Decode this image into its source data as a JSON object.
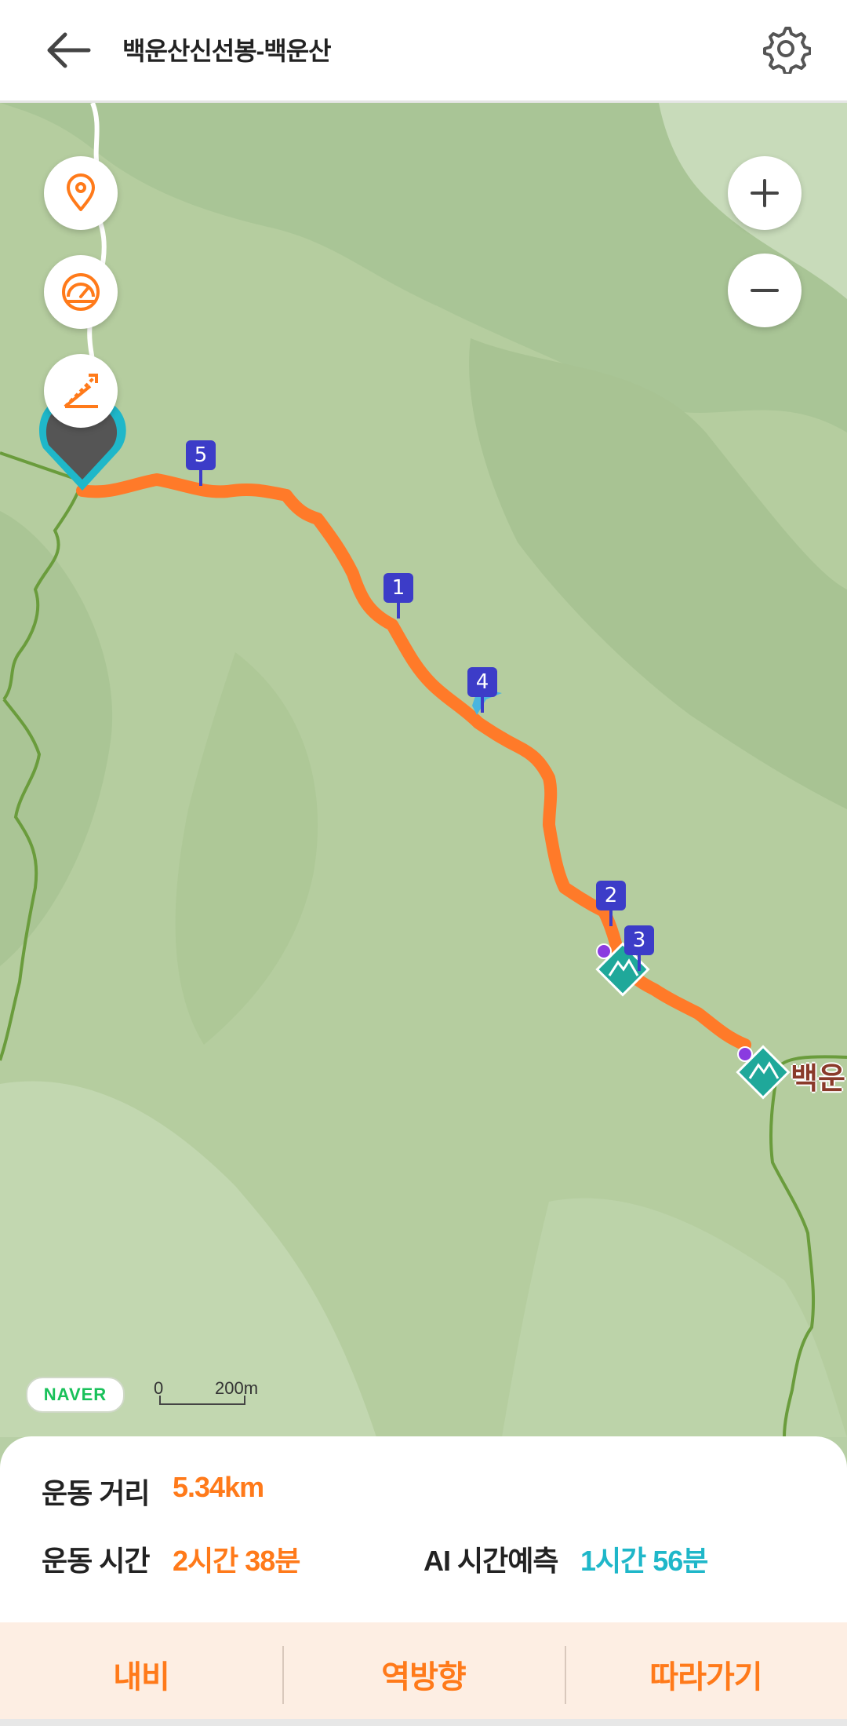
{
  "header": {
    "title": "백운산신선봉-백운산",
    "back_icon": "arrow-left-icon",
    "settings_icon": "gear-icon"
  },
  "map": {
    "controls": {
      "left": [
        "location-pin-icon",
        "speedometer-icon",
        "elevation-slope-icon"
      ],
      "zoom_in": "+",
      "zoom_out": "−"
    },
    "waypoints": [
      {
        "label": "5"
      },
      {
        "label": "1"
      },
      {
        "label": "4"
      },
      {
        "label": "2"
      },
      {
        "label": "3"
      }
    ],
    "peak_label": "백운",
    "naver_logo": "NAVER",
    "scale": {
      "zero": "0",
      "label": "200m"
    },
    "colors": {
      "route": "#ff7a29",
      "trail": "#6a9c3c",
      "waypoint": "#3c3cc8",
      "peak_marker": "#1fa89a"
    }
  },
  "stats": {
    "distance_label": "운동 거리",
    "distance_value": "5.34km",
    "time_label": "운동 시간",
    "time_value": "2시간 38분",
    "ai_label": "AI 시간예측",
    "ai_value": "1시간 56분"
  },
  "actions": {
    "navi": "내비",
    "reverse": "역방향",
    "follow": "따라가기"
  },
  "colors": {
    "accent": "#ff7a1a",
    "ai_teal": "#1fb7c9",
    "action_bar_bg": "#fdeee3"
  }
}
